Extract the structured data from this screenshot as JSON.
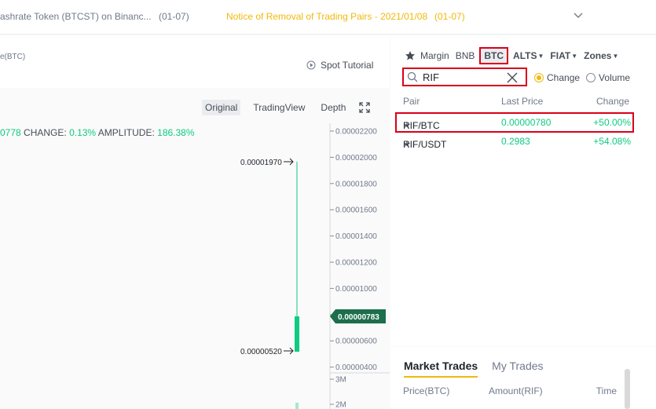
{
  "notice": {
    "item1": "ashrate Token (BTCST) on Binanc...",
    "item1_date": "(01-07)",
    "item2": "Notice of Removal of Trading Pairs - 2021/01/08",
    "item2_date": "(01-07)"
  },
  "chart_header": {
    "pair_sub": "e(BTC)",
    "spot_tutorial": "Spot Tutorial"
  },
  "view_tabs": {
    "original": "Original",
    "tradingview": "TradingView",
    "depth": "Depth"
  },
  "stats": {
    "value_prefix": "0778",
    "change_label": "CHANGE:",
    "change_value": "0.13%",
    "amplitude_label": "AMPLITUDE:",
    "amplitude_value": "186.38%"
  },
  "chart": {
    "price_ticks": [
      "0.00002200",
      "0.00002000",
      "0.00001800",
      "0.00001600",
      "0.00001400",
      "0.00001200",
      "0.00001000",
      "0.00000800",
      "0.00000600",
      "0.00000400"
    ],
    "volume_ticks": [
      "3M",
      "2M"
    ],
    "high_label": "0.00001970",
    "low_label": "0.00000520",
    "current_price": "0.00000783"
  },
  "market": {
    "tabs": {
      "margin": "Margin",
      "bnb": "BNB",
      "btc": "BTC",
      "alts": "ALTS",
      "fiat": "FIAT",
      "zones": "Zones"
    },
    "search_value": "RIF",
    "radio_change": "Change",
    "radio_volume": "Volume",
    "columns": {
      "pair": "Pair",
      "last_price": "Last Price",
      "change": "Change"
    },
    "rows": [
      {
        "pair": "RIF/BTC",
        "price": "0.00000780",
        "change": "+50.00%"
      },
      {
        "pair": "RIF/USDT",
        "price": "0.2983",
        "change": "+54.08%"
      }
    ]
  },
  "trades": {
    "tab_market": "Market Trades",
    "tab_my": "My Trades",
    "col_price": "Price(BTC)",
    "col_amount": "Amount(RIF)",
    "col_time": "Time"
  },
  "colors": {
    "accent": "#f0b90b",
    "up": "#0ecb81",
    "highlight": "#d9001b"
  }
}
